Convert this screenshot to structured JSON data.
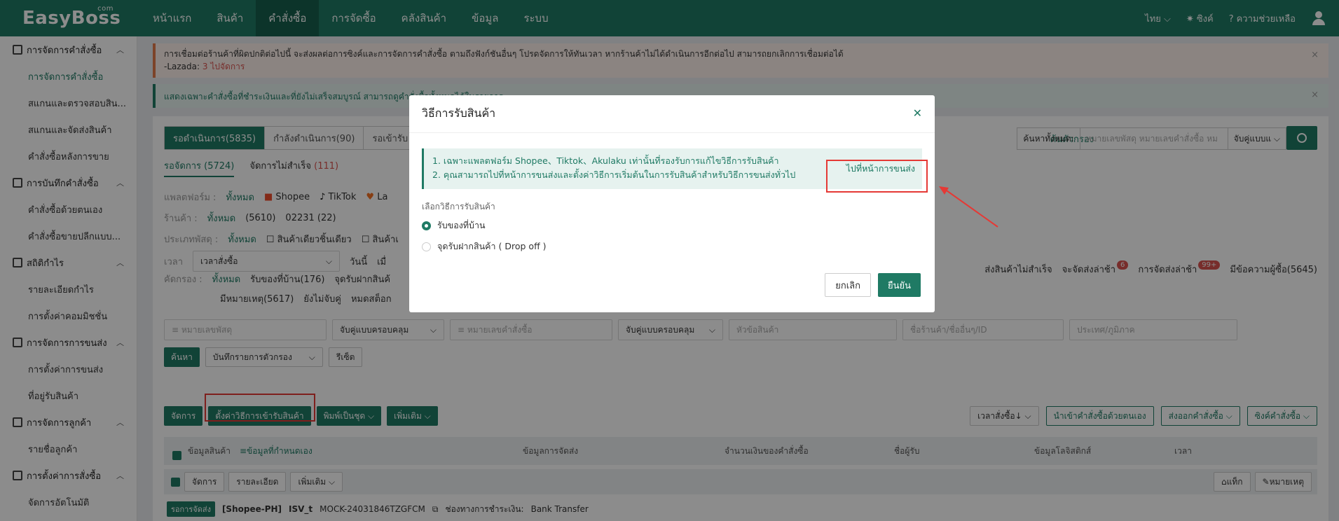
{
  "app": {
    "logo": "EasyBoss",
    "logo_sup": "com"
  },
  "topnav": [
    "หน้าแรก",
    "สินค้า",
    "คำสั่งซื้อ",
    "การจัดซื้อ",
    "คลังสินค้า",
    "ข้อมูล",
    "ระบบ"
  ],
  "topright": {
    "lang": "ไทย",
    "sync": "ซิงค์",
    "help": "ความช่วยเหลือ"
  },
  "sidebar": {
    "groups": [
      {
        "label": "การจัดการคำสั่งซื้อ",
        "items": [
          "การจัดการคำสั่งซื้อ",
          "สแกนและตรวจสอบสิน...",
          "สแกนและจัดส่งสินค้า",
          "คำสั่งซื้อหลังการขาย"
        ]
      },
      {
        "label": "การบันทึกคำสั่งซื้อ",
        "items": [
          "คำสั่งซื้อด้วยตนเอง",
          "คำสั่งซื้อขายปลีกแบบ..."
        ]
      },
      {
        "label": "สถิติกำไร",
        "items": [
          "รายละเอียดกำไร",
          "การตั้งค่าคอมมิชชั่น"
        ]
      },
      {
        "label": "การจัดการการขนส่ง",
        "items": [
          "การตั้งค่าการขนส่ง",
          "ที่อยู่รับสินค้า"
        ]
      },
      {
        "label": "การจัดการลูกค้า",
        "items": [
          "รายชื่อลูกค้า"
        ]
      },
      {
        "label": "การตั้งค่าการสั่งซื้อ",
        "items": [
          "จัดการอัตโนมัติ"
        ]
      }
    ]
  },
  "alerts": {
    "warn_line1": "การเชื่อมต่อร้านค้าที่ผิดปกติต่อไปนี้ จะส่งผลต่อการซิงค์และการจัดการคำสั่งซื้อ ตามถึงฟังก์ชันอื่นๆ โปรดจัดการให้ทันเวลา หากร้านค้าไม่ได้ดำเนินการอีกต่อไป สามารถยกเลิกการเชื่อมต่อได้",
    "warn_line2_prefix": "-Lazada:",
    "warn_count": "3",
    "warn_link": "ไปจัดการ",
    "info": "แสดงเฉพาะคำสั่งซื้อที่ชำระเงินและที่ยังไม่เสร็จสมบูรณ์ สามารถดูคำสั่งซื้อทั้งหมดได้ในรายการ"
  },
  "tabs": [
    "รอดำเนินการ(5835)",
    "กำลังดำเนินการ(90)",
    "รอเข้ารับ"
  ],
  "subtabs": {
    "active": "รอจัดการ (5724)",
    "fail": "จัดการไม่สำเร็จ",
    "fail_count": "(111)"
  },
  "filters": {
    "platform_label": "แพลตฟอร์ม :",
    "platform_all": "ทั้งหมด",
    "platforms": [
      "Shopee",
      "TikTok",
      "La"
    ],
    "shop_label": "ร้านค้า :",
    "shop_all": "ทั้งหมด",
    "shops": [
      "(5610)",
      "02231 (22)"
    ],
    "parcel_label": "ประเภทพัสดุ :",
    "parcel_all": "ทั้งหมด",
    "parcel_opts": [
      "สินค้าเดียวชิ้นเดียว",
      "สินค้าเ"
    ],
    "time_label": "เวลา",
    "time_select": "เวลาสั่งซื้อ",
    "time_opts": [
      "วันนี้",
      "เมื่"
    ],
    "sort_label": "คัดกรอง :",
    "sort_all": "ทั้งหมด",
    "sort_opts": [
      "รับของที่บ้าน(176)",
      "จุดรับฝากสินค้"
    ],
    "sort_opts2": [
      "มีหมายเหตุ(5617)",
      "ยังไม่จับคู่",
      "หมดสต็อก"
    ]
  },
  "right_opts": [
    {
      "label": "ส่งสินค้าไม่สำเร็จ",
      "badge": ""
    },
    {
      "label": "จะจัดส่งล่าช้า",
      "badge": "6"
    },
    {
      "label": "การจัดส่งล่าช้า",
      "badge": "99+"
    },
    {
      "label": "มีข้อความผู้ซื้อ(5645)",
      "badge": ""
    }
  ],
  "search": {
    "tab_label": "ค้นตัวกรอง",
    "scope": "ค้นหาทั้งหมด:",
    "placeholder": "หมายเลขพัสดุ หมายเลขคำสั่งซื้อ หม",
    "match": "จับคู่แบบแ"
  },
  "inputs": [
    "หมายเลขพัสดุ",
    "จับคู่แบบครอบคลุม",
    "หมายเลขคำสั่งซื้อ",
    "จับคู่แบบครอบคลุม",
    "หัวข้อสินค้า",
    "ชื่อร้านค้า/ชื่ออื่นๆ/ID",
    "ประเทศ/ภูมิภาค"
  ],
  "btns": {
    "search": "ค้นหา",
    "saved_filter": "บันทึกรายการตัวกรอง",
    "reset": "รีเซ็ต"
  },
  "actions": {
    "manage": "จัดการ",
    "set_pickup": "ตั้งค่าวิธีการเข้ารับสินค้า",
    "print": "พิมพ์เป็นชุด",
    "more": "เพิ่มเติม",
    "sort": "เวลาสั่งซื้อ↓",
    "import": "นำเข้าคำสั่งซื้อด้วยตนเอง",
    "export": "ส่งออกคำสั่งซื้อ",
    "sync": "ซิงค์คำสั่งซื้อ"
  },
  "table": {
    "headers": [
      "ข้อมูลสินค้า",
      "≡ข้อมูลที่กำหนดเอง",
      "ข้อมูลการจัดส่ง",
      "จำนวนเงินของคำสั่งซื้อ",
      "ชื่อผู้รับ",
      "ข้อมูลโลจิสติกส์",
      "เวลา"
    ],
    "row_actions": [
      "จัดการ",
      "รายละเอียด",
      "เพิ่มเติม"
    ],
    "row_right": [
      "แท็ก",
      "หมายเหตุ"
    ],
    "order": {
      "status": "รอการจัดส่ง",
      "shop": "[Shopee-PH]",
      "isv": "ISV_t",
      "order_no": "MOCK-24031846TZGFCM",
      "pay_label": "ช่องทางการชำระเงิน:",
      "pay": "Bank Transfer"
    }
  },
  "modal": {
    "title": "วิธีการรับสินค้า",
    "note1": "1. เฉพาะแพลตฟอร์ม Shopee、Tiktok、Akulaku เท่านั้นที่รองรับการแก้ไขวิธีการรับสินค้า",
    "note2": "2. คุณสามารถไปที่หน้าการขนส่งและตั้งค่าวิธีการเริ่มต้นในการรับสินค้าสำหรับวิธีการขนส่งทั่วไป",
    "link": "ไปที่หน้าการขนส่ง",
    "choose_label": "เลือกวิธีการรับสินค้า",
    "opt1": "รับของที่บ้าน",
    "opt2": "จุดรับฝากสินค้า ( Drop off )",
    "cancel": "ยกเลิก",
    "confirm": "ยืนยัน"
  },
  "colors": {
    "brand": "#1f7a64",
    "highlight": "#e53935"
  }
}
